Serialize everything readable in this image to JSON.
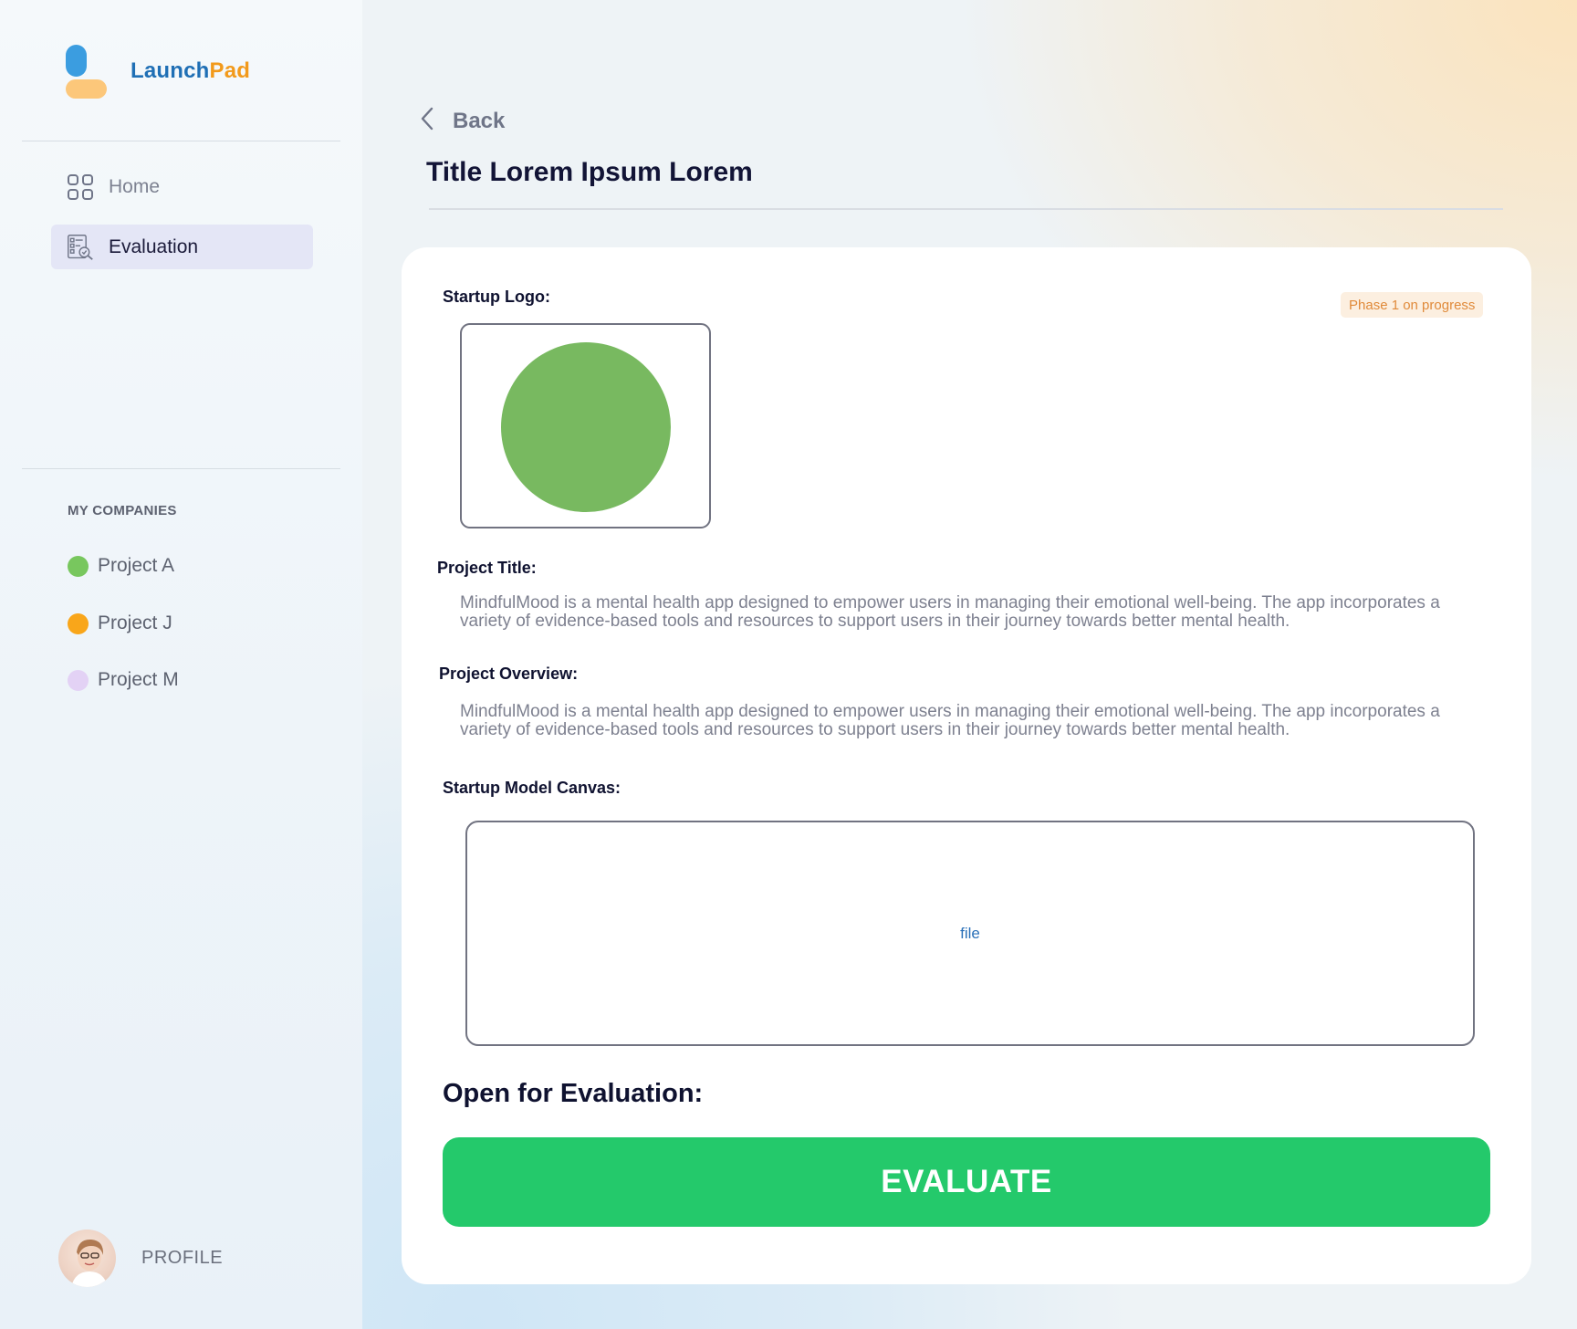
{
  "app": {
    "brand_part1": "Launch",
    "brand_part2": "Pad"
  },
  "sidebar": {
    "nav": [
      {
        "label": "Home",
        "icon": "grid-icon",
        "active": false
      },
      {
        "label": "Evaluation",
        "icon": "evaluation-report-icon",
        "active": true
      }
    ],
    "companies_heading": "MY COMPANIES",
    "companies": [
      {
        "label": "Project A",
        "color": "#78c75e"
      },
      {
        "label": "Project J",
        "color": "#f9a61a"
      },
      {
        "label": "Project M",
        "color": "#e3d2f5"
      }
    ],
    "profile_label": "PROFILE"
  },
  "header": {
    "back_label": "Back",
    "title": "Title Lorem Ipsum Lorem"
  },
  "card": {
    "startup_logo_label": "Startup Logo:",
    "status_badge": "Phase 1 on progress",
    "logo_color": "#78b960",
    "project_title_label": "Project Title:",
    "project_title_text": "MindfulMood is a mental health app designed to empower users in managing their emotional well‑being. The app incorporates a variety of evidence‑based tools and resources to support users in their journey towards better mental health.",
    "project_overview_label": "Project Overview:",
    "project_overview_text": "MindfulMood is a mental health app designed to empower users in managing their emotional well‑being. The app incorporates a variety of evidence‑based tools and resources to support users in their journey towards better mental health.",
    "canvas_label": "Startup Model Canvas:",
    "canvas_file_label": "file",
    "open_for_evaluation": "Open for Evaluation:",
    "evaluate_button": "EVALUATE"
  },
  "colors": {
    "accent_green": "#24c96b",
    "brand_blue": "#1f6fb5",
    "brand_orange": "#f29a1b",
    "active_nav_bg": "#e4e6f6"
  }
}
